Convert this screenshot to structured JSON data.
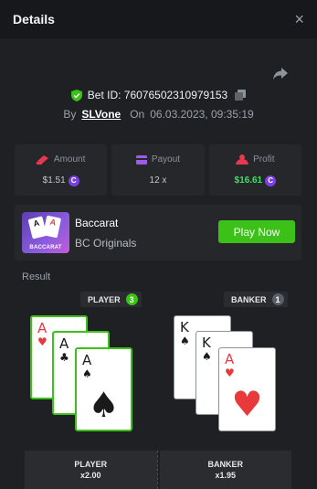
{
  "header": {
    "title": "Details",
    "close_symbol": "×"
  },
  "bet": {
    "id_text": "Bet ID: 76076502310979153",
    "by_label": "By",
    "user": "SLVone",
    "on_label": "On",
    "datetime": "06.03.2023, 09:35:19"
  },
  "stats": {
    "amount": {
      "label": "Amount",
      "value": "$1.51"
    },
    "payout": {
      "label": "Payout",
      "value": "12 x"
    },
    "profit": {
      "label": "Profit",
      "value": "$16.61"
    }
  },
  "game": {
    "name": "Baccarat",
    "provider": "BC Originals",
    "thumb_text": "BACCARAT",
    "play_label": "Play Now"
  },
  "result": {
    "label": "Result",
    "player": {
      "label": "PLAYER",
      "count": "3"
    },
    "banker": {
      "label": "BANKER",
      "count": "1"
    },
    "player_cards": [
      {
        "rank": "A",
        "suit": "♥",
        "color": "red"
      },
      {
        "rank": "A",
        "suit": "♣",
        "color": "black"
      },
      {
        "rank": "A",
        "suit": "♠",
        "color": "black"
      }
    ],
    "banker_cards": [
      {
        "rank": "K",
        "suit": "♠",
        "color": "black"
      },
      {
        "rank": "K",
        "suit": "♠",
        "color": "black"
      },
      {
        "rank": "A",
        "suit": "♥",
        "color": "red"
      }
    ]
  },
  "bottom": {
    "player": {
      "label": "PLAYER",
      "odds": "x2.00"
    },
    "banker": {
      "label": "BANKER",
      "odds": "x1.95"
    }
  },
  "coin_symbol": "C",
  "colors": {
    "accent_green": "#3bc117",
    "profit_green": "#3fe064",
    "coin_purple": "#7b3fe4"
  },
  "icons": [
    "close-icon",
    "share-icon",
    "shield-check-icon",
    "copy-icon",
    "amount-icon",
    "payout-icon",
    "profit-icon",
    "coin-icon"
  ]
}
